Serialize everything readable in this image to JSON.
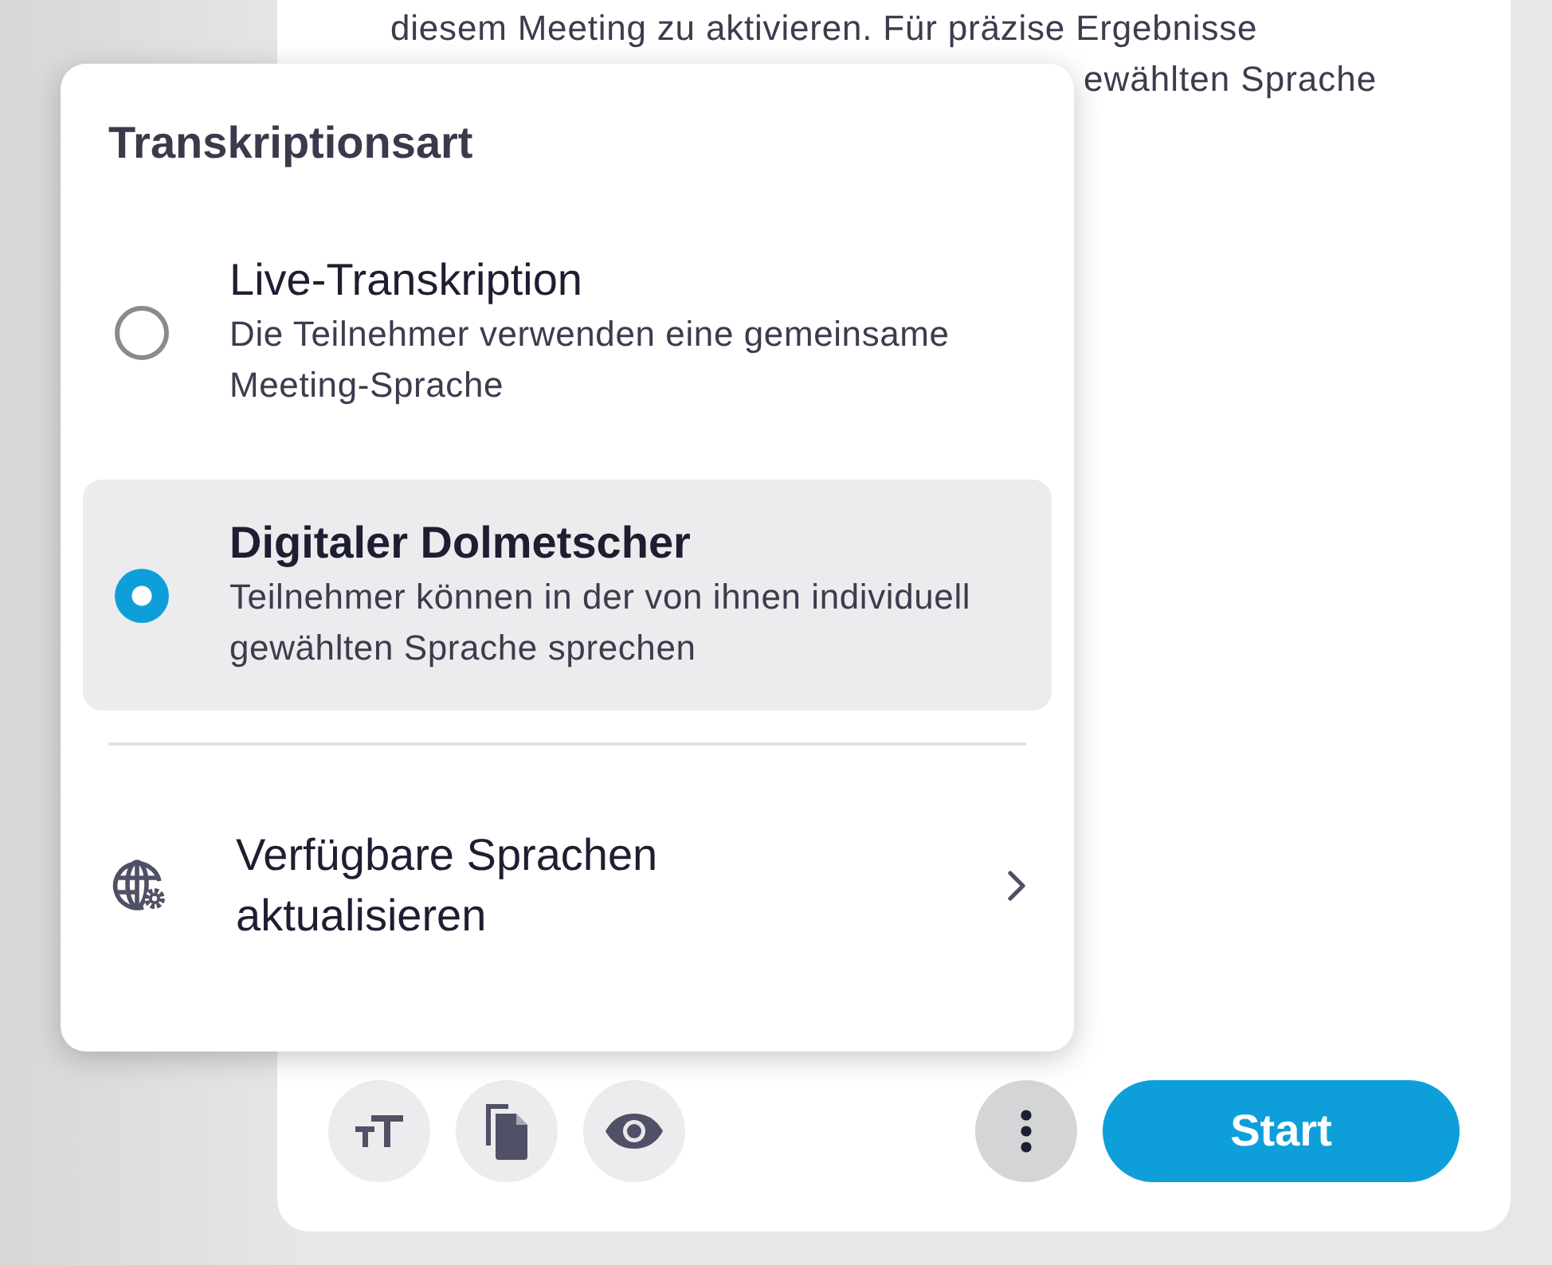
{
  "background_text": {
    "lines": [
      {
        "text": "diesem Meeting zu aktivieren. Für präzise Ergebnisse",
        "kind": "full"
      },
      {
        "text": "ewählten Sprache",
        "kind": "tail"
      }
    ]
  },
  "popup": {
    "title": "Transkriptionsart",
    "options": [
      {
        "title": "Live-Transkription",
        "description": "Die Teilnehmer verwenden eine gemeinsame Meeting-Sprache",
        "selected": false
      },
      {
        "title": "Digitaler Dolmetscher",
        "description": "Teilnehmer können in der von ihnen individuell gewählten Sprache sprechen",
        "selected": true
      }
    ],
    "menu_item": {
      "label": "Verfügbare Sprachen aktualisieren"
    }
  },
  "toolbar": {
    "tools": [
      {
        "kind": "text-size"
      },
      {
        "kind": "copy"
      },
      {
        "kind": "view"
      }
    ],
    "start_button": "Start"
  }
}
